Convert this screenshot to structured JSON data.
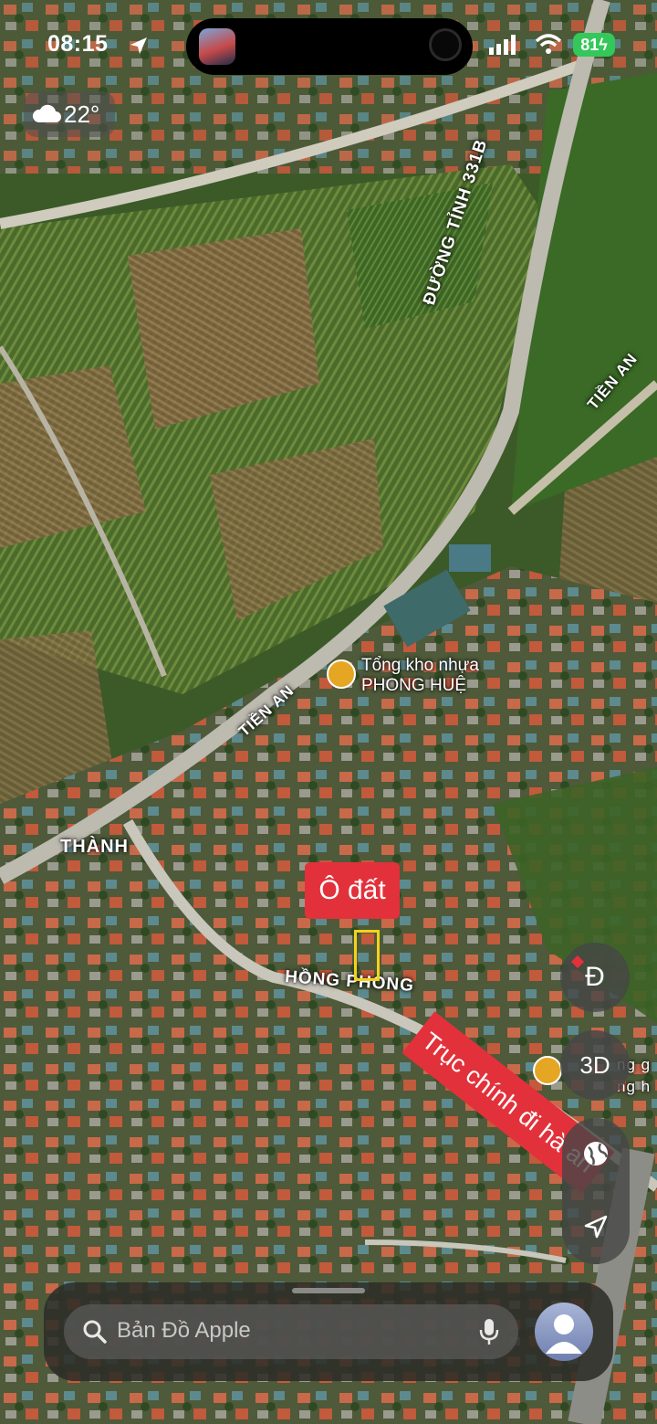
{
  "status_bar": {
    "time": "08:15",
    "battery": "81"
  },
  "weather": {
    "temperature": "22°",
    "icon": "cloud-icon"
  },
  "map": {
    "labels": {
      "road_331b": "ĐƯỜNG TỈNH 331B",
      "tien_an_upper": "TIỀN AN",
      "tien_an_lower": "TIỀN AN",
      "thanh": "THÀNH",
      "hong_phong": "HỒNG PHONG",
      "partial_right": "ng g\nng h"
    },
    "poi": {
      "line1": "Tổng kho nhựa",
      "line2": "PHONG HUỆ"
    }
  },
  "annotations": {
    "plot_label": "Ô đất",
    "route_label": "Trục chính đi hà an"
  },
  "controls": {
    "compass_letter": "Đ",
    "view_3d": "3D"
  },
  "search": {
    "placeholder": "Bản Đồ Apple"
  },
  "colors": {
    "annotation_red": "#e2313a",
    "plot_marker": "#f4d21a",
    "poi_orange": "#e5a623",
    "battery_green": "#34c759"
  }
}
